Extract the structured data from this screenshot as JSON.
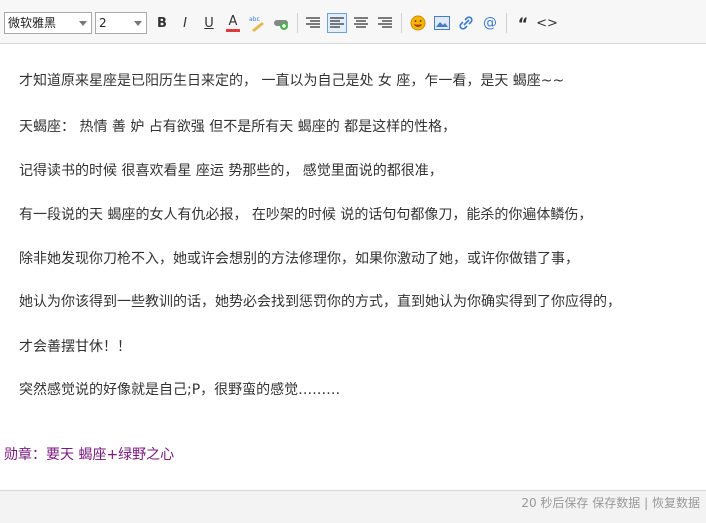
{
  "toolbar": {
    "font_family": "微软雅黑",
    "font_size": "2",
    "bold_label": "B",
    "italic_label": "I",
    "underline_label": "U",
    "font_color_label": "A",
    "spell_label": "abc",
    "quote_label": "“",
    "code_label": "<>",
    "at_label": "@",
    "font_color_bar": "#e03a3a"
  },
  "content": {
    "lines": [
      "才知道原来星座是已阳历生日来定的， 一直以为自己是处 女 座，乍一看，是天 蝎座~~",
      "天蝎座： 热情 善 妒 占有欲强   但不是所有天 蝎座的  都是这样的性格，",
      "记得读书的时候 很喜欢看星 座运 势那些的， 感觉里面说的都很准，",
      "有一段说的天 蝎座的女人有仇必报， 在吵架的时候 说的话句句都像刀，能杀的你遍体鳞伤，",
      "除非她发现你刀枪不入，她或许会想别的方法修理你，如果你激动了她，或许你做错了事，",
      "她认为你该得到一些教训的话，她势必会找到惩罚你的方式，直到她认为你确实得到了你应得的，",
      "才会善摆甘休！！",
      "突然感觉说的好像就是自己;P，很野蛮的感觉………"
    ],
    "medal_label": "勋章：",
    "medal_value": "要天 蝎座+绿野之心"
  },
  "status": {
    "autosave": "20 秒后保存",
    "save": "保存数据",
    "divider": "|",
    "restore": "恢复数据"
  }
}
